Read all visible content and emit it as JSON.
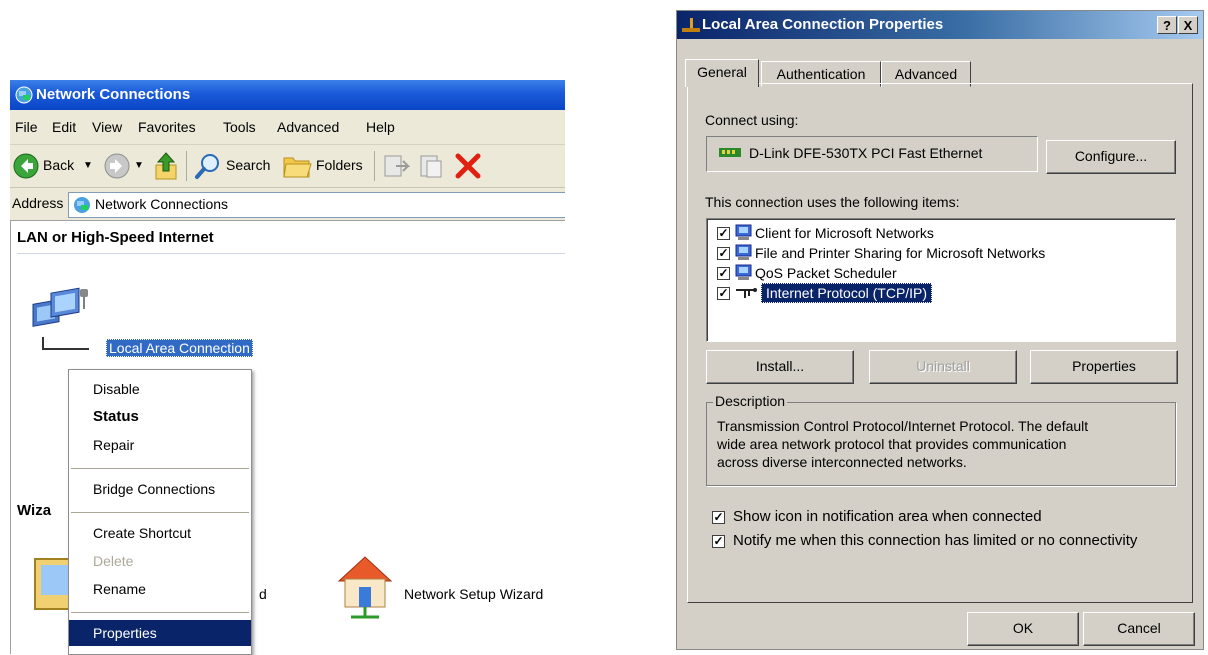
{
  "network_connections": {
    "title": "Network Connections",
    "menu": [
      "File",
      "Edit",
      "View",
      "Favorites",
      "Tools",
      "Advanced",
      "Help"
    ],
    "toolbar": {
      "back": "Back",
      "search": "Search",
      "folders": "Folders"
    },
    "address_label": "Address",
    "address_value": "Network Connections",
    "section_lan": "LAN or High-Speed Internet",
    "section_wizard_partial": "Wiza",
    "local_area_connection": "Local Area Connection",
    "wizard_partial_label": "d",
    "network_setup_wizard": "Network Setup Wizard",
    "context_menu": {
      "disable": "Disable",
      "status": "Status",
      "repair": "Repair",
      "bridge": "Bridge Connections",
      "create_shortcut": "Create Shortcut",
      "delete": "Delete",
      "rename": "Rename",
      "properties": "Properties"
    }
  },
  "properties_dialog": {
    "title": "Local Area Connection Properties",
    "title_help": "?",
    "title_close": "X",
    "tabs": [
      "General",
      "Authentication",
      "Advanced"
    ],
    "connect_using_label": "Connect using:",
    "adapter": "D-Link DFE-530TX PCI Fast Ethernet",
    "configure_button": "Configure...",
    "items_label": "This connection uses the following items:",
    "items": [
      {
        "label": "Client for Microsoft Networks",
        "checked": true,
        "selected": false
      },
      {
        "label": "File and Printer Sharing for Microsoft Networks",
        "checked": true,
        "selected": false
      },
      {
        "label": "QoS Packet Scheduler",
        "checked": true,
        "selected": false
      },
      {
        "label": "Internet Protocol (TCP/IP)",
        "checked": true,
        "selected": true
      }
    ],
    "install_button": "Install...",
    "uninstall_button": "Uninstall",
    "properties_button": "Properties",
    "description_label": "Description",
    "description_lines": [
      "Transmission Control Protocol/Internet Protocol. The default",
      "wide area network protocol that provides communication",
      "across diverse interconnected networks."
    ],
    "show_icon_label": "Show icon in notification area when connected",
    "show_icon_checked": true,
    "notify_label": "Notify me when this connection has limited or no connectivity",
    "notify_checked": true,
    "ok_button": "OK",
    "cancel_button": "Cancel",
    "colors": {
      "selection": "#0a246a",
      "dialog_bg": "#d4d0c8",
      "xp_title": "#0a46c8"
    }
  }
}
